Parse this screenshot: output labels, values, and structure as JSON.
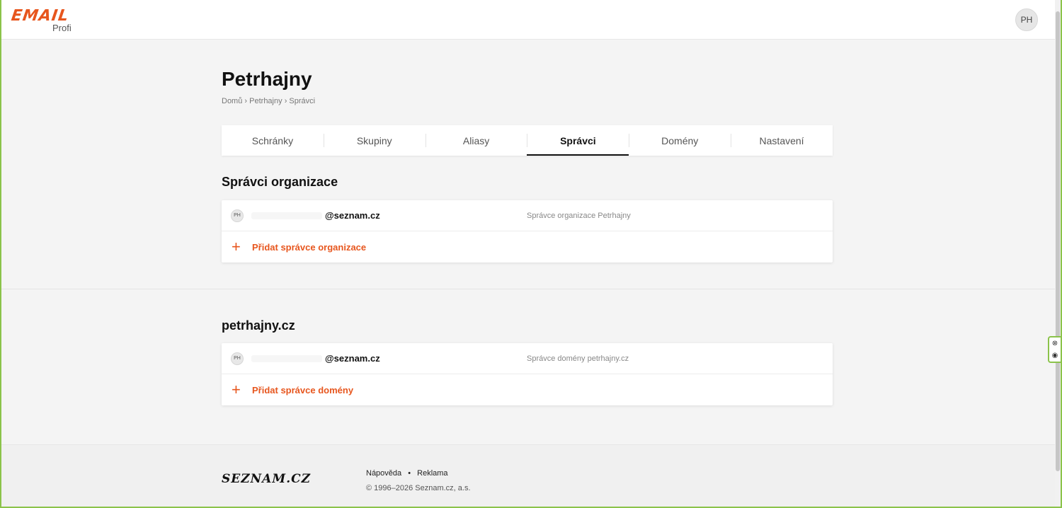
{
  "header": {
    "logo_word": "EMAIL",
    "logo_sub": "Profi",
    "user_initials": "PH"
  },
  "page": {
    "title": "Petrhajny",
    "breadcrumb": [
      "Domů",
      "Petrhajny",
      "Správci"
    ],
    "breadcrumb_sep": "›"
  },
  "tabs": [
    {
      "label": "Schránky",
      "active": false
    },
    {
      "label": "Skupiny",
      "active": false
    },
    {
      "label": "Aliasy",
      "active": false
    },
    {
      "label": "Správci",
      "active": true
    },
    {
      "label": "Domény",
      "active": false
    },
    {
      "label": "Nastavení",
      "active": false
    }
  ],
  "org_section": {
    "title": "Správci organizace",
    "admin": {
      "initials": "PH",
      "email": "@seznam.cz",
      "role": "Správce organizace Petrhajny"
    },
    "add_label": "Přidat správce organizace"
  },
  "domain_section": {
    "title": "petrhajny.cz",
    "admin": {
      "initials": "PH",
      "email": "@seznam.cz",
      "role": "Správce domény petrhajny.cz"
    },
    "add_label": "Přidat správce domény"
  },
  "footer": {
    "logo_text": "SEZNAM.CZ",
    "help": "Nápověda",
    "separator": "•",
    "ads": "Reklama",
    "copyright": "© 1996–2026 Seznam.cz, a.s."
  },
  "colors": {
    "accent": "#e7561e",
    "frame": "#8bc34a"
  }
}
